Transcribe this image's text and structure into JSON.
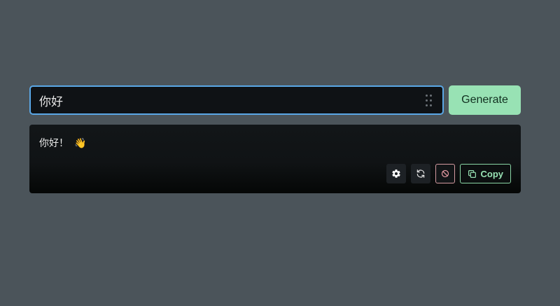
{
  "prompt": {
    "value": "你好",
    "placeholder": ""
  },
  "generate_button": {
    "label": "Generate"
  },
  "output": {
    "text": "你好！",
    "emoji": "👋"
  },
  "actions": {
    "settings_icon": "gear-icon",
    "regenerate_icon": "refresh-icon",
    "stop_icon": "stop-icon",
    "copy_icon": "copy-icon",
    "copy_label": "Copy"
  },
  "colors": {
    "background": "#4b545a",
    "input_border": "#5aa7e6",
    "accent_green": "#98e2b4",
    "stop_border": "#d49aa0"
  }
}
